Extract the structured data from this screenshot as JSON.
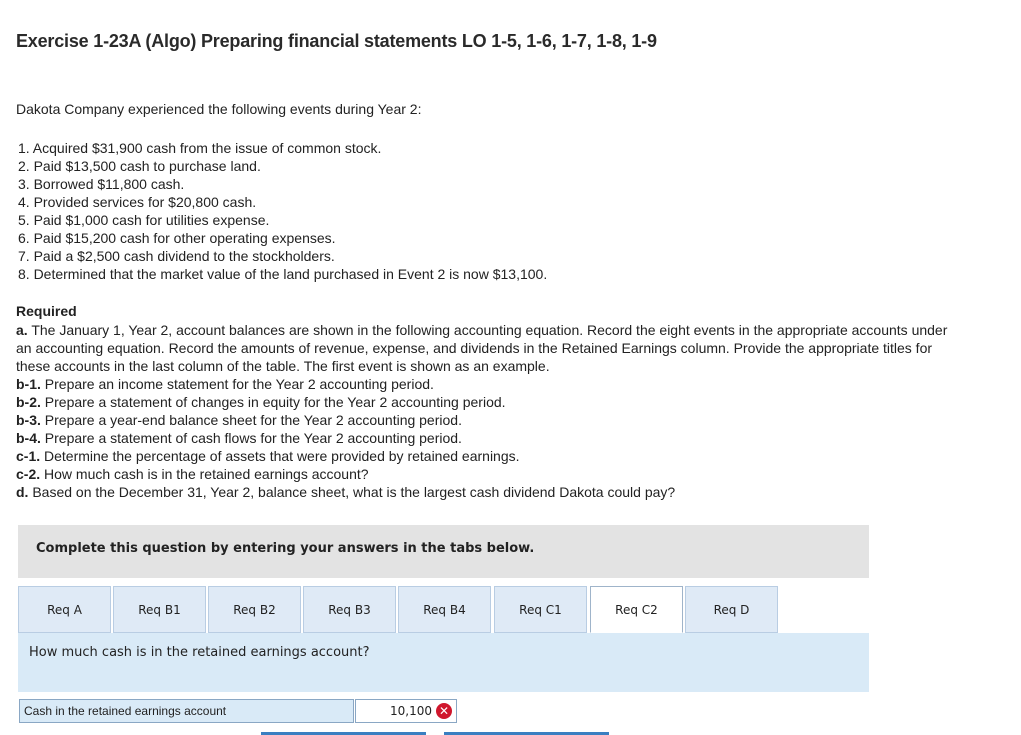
{
  "title": "Exercise 1-23A (Algo) Preparing financial statements LO 1-5, 1-6, 1-7, 1-8, 1-9",
  "intro": "Dakota Company experienced the following events during Year 2:",
  "events": [
    "1. Acquired $31,900 cash from the issue of common stock.",
    "2. Paid $13,500 cash to purchase land.",
    "3. Borrowed $11,800 cash.",
    "4. Provided services for $20,800 cash.",
    "5. Paid $1,000 cash for utilities expense.",
    "6. Paid $15,200 cash for other operating expenses.",
    "7. Paid a $2,500 cash dividend to the stockholders.",
    "8. Determined that the market value of the land purchased in Event 2 is now $13,100."
  ],
  "required_heading": "Required",
  "requirements": [
    {
      "label": "a.",
      "text": " The January 1, Year 2, account balances are shown in the following accounting equation. Record the eight events in the appropriate accounts under an accounting equation. Record the amounts of revenue, expense, and dividends in the Retained Earnings column. Provide the appropriate titles for these accounts in the last column of the table. The first event is shown as an example."
    },
    {
      "label": "b-1.",
      "text": " Prepare an income statement for the Year 2 accounting period."
    },
    {
      "label": "b-2.",
      "text": " Prepare a statement of changes in equity for the Year 2 accounting period."
    },
    {
      "label": "b-3.",
      "text": " Prepare a year-end balance sheet for the Year 2 accounting period."
    },
    {
      "label": "b-4.",
      "text": " Prepare a statement of cash flows for the Year 2 accounting period."
    },
    {
      "label": "c-1.",
      "text": " Determine the percentage of assets that were provided by retained earnings."
    },
    {
      "label": "c-2.",
      "text": " How much cash is in the retained earnings account?"
    },
    {
      "label": "d.",
      "text": " Based on the December 31, Year 2, balance sheet, what is the largest cash dividend Dakota could pay?"
    }
  ],
  "instructions": "Complete this question by entering your answers in the tabs below.",
  "tabs": [
    "Req A",
    "Req B1",
    "Req B2",
    "Req B3",
    "Req B4",
    "Req C1",
    "Req C2",
    "Req D"
  ],
  "active_tab": "Req C2",
  "question": "How much cash is in the retained earnings account?",
  "answer": {
    "label": "Cash in the retained earnings account",
    "value": "10,100",
    "status_icon": "incorrect-x-icon",
    "status_color": "#d0172d"
  }
}
